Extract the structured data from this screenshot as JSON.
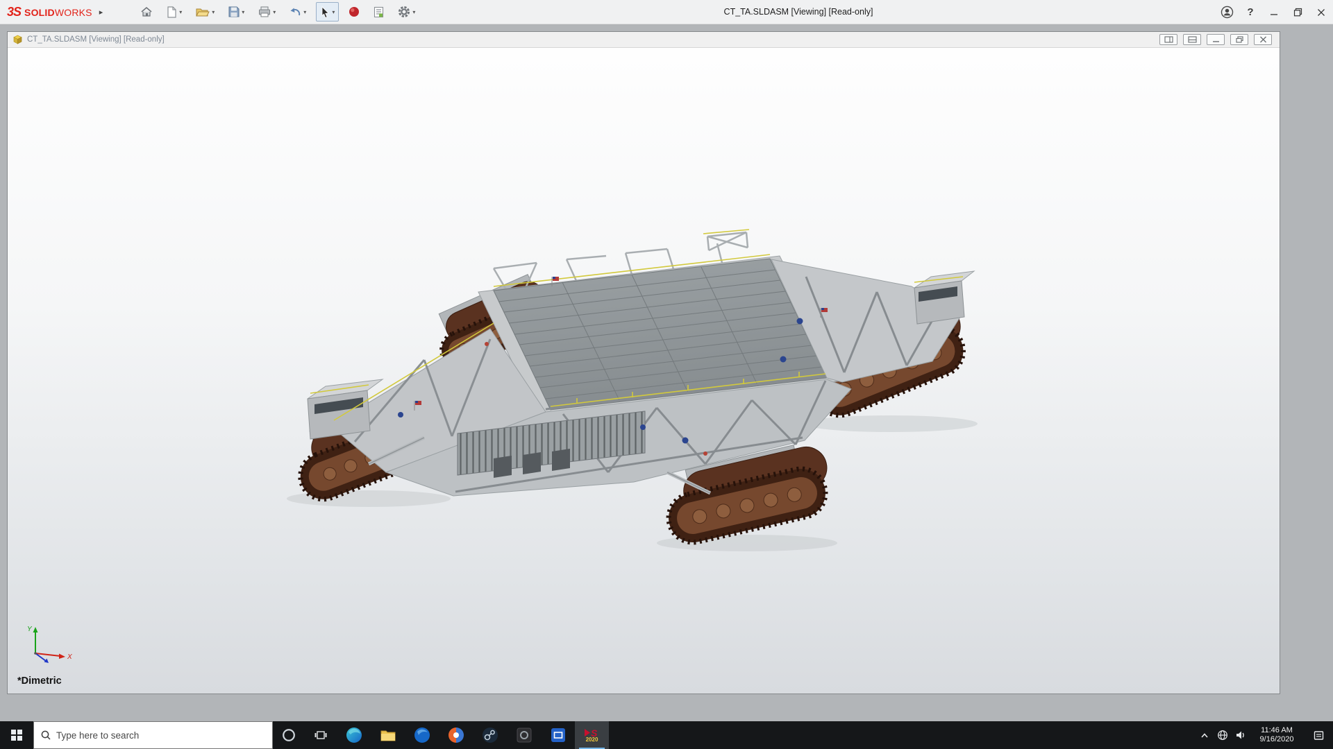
{
  "colors": {
    "brand_red": "#e2231a",
    "taskbar_bg": "#151719",
    "active_underline": "#75b6e8",
    "viewport_top": "#fefefe",
    "viewport_bottom": "#d8dbdf"
  },
  "titlebar": {
    "brand_prefix": "3S",
    "brand_bold": "SOLID",
    "brand_light": "WORKS",
    "window_title": "CT_TA.SLDASM [Viewing] [Read-only]"
  },
  "document": {
    "title": "CT_TA.SLDASM [Viewing] [Read-only]",
    "view_orientation": "*Dimetric",
    "triad": {
      "x_label": "X",
      "y_label": "Y"
    }
  },
  "taskbar": {
    "search_placeholder": "Type here to search",
    "solidworks_badge": "2020",
    "clock": {
      "time": "11:46 AM",
      "date": "9/16/2020"
    }
  }
}
